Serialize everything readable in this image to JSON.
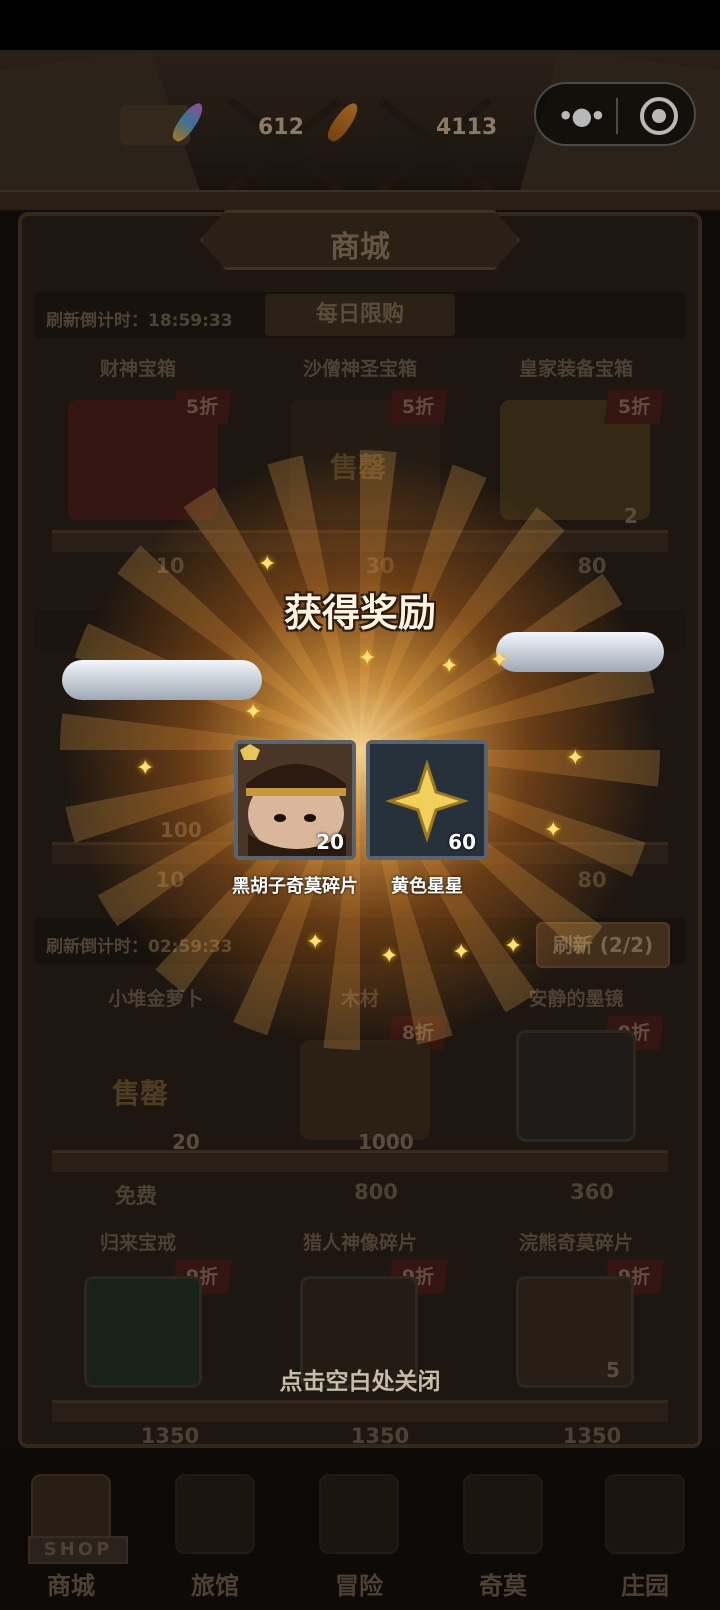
{
  "top_bar": {
    "resources": [
      {
        "icon": "rainbow-carrot-icon",
        "value": "612"
      },
      {
        "icon": "carrot-icon",
        "value": "4113"
      }
    ],
    "menu_capsule": {
      "more_icon": "more-dots-icon",
      "close_icon": "target-circle-icon"
    }
  },
  "shop": {
    "title": "商城",
    "daily": {
      "refresh_timer": "刷新倒计时：18:59:33",
      "tab_label": "每日限购",
      "items": [
        {
          "name": "财神宝箱",
          "badge": "5折",
          "price": "10",
          "sold_out": ""
        },
        {
          "name": "沙僧神圣宝箱",
          "badge": "5折",
          "price": "30",
          "sold_out": "售罄"
        },
        {
          "name": "皇家装备宝箱",
          "badge": "5折",
          "price": "80",
          "qty": "2"
        }
      ],
      "row2_prices": [
        "10",
        "80"
      ],
      "row2_qty": "100"
    },
    "special": {
      "refresh_timer": "刷新倒计时：02:59:33",
      "refresh_button": "刷新 (2/2)",
      "items": [
        {
          "name": "小堆金萝卜",
          "badge": "",
          "price": "免费",
          "qty": "20",
          "sold_out": "售罄"
        },
        {
          "name": "木材",
          "badge": "8折",
          "price": "800",
          "qty": "1000"
        },
        {
          "name": "安静的墨镜",
          "badge": "9折",
          "price": "360"
        },
        {
          "name": "归来宝戒",
          "badge": "9折",
          "price": "1350"
        },
        {
          "name": "猎人神像碎片",
          "badge": "9折",
          "price": "1350"
        },
        {
          "name": "浣熊奇莫碎片",
          "badge": "9折",
          "price": "1350",
          "qty": "5"
        }
      ]
    }
  },
  "bottom_nav": {
    "shop_sign": "SHOP",
    "items": [
      {
        "label": "商城",
        "icon": "shop-icon",
        "active": true
      },
      {
        "label": "旅馆",
        "icon": "inn-icon"
      },
      {
        "label": "冒险",
        "icon": "crossed-swords-icon"
      },
      {
        "label": "奇莫",
        "icon": "qimo-icon"
      },
      {
        "label": "庄园",
        "icon": "manor-icon"
      }
    ]
  },
  "reward_popup": {
    "title": "获得奖励",
    "rewards": [
      {
        "label": "黑胡子奇莫碎片",
        "count": "20",
        "icon": "bearded-pirate-shard-icon"
      },
      {
        "label": "黄色星星",
        "count": "60",
        "icon": "yellow-star-icon"
      }
    ],
    "close_hint": "点击空白处关闭"
  }
}
